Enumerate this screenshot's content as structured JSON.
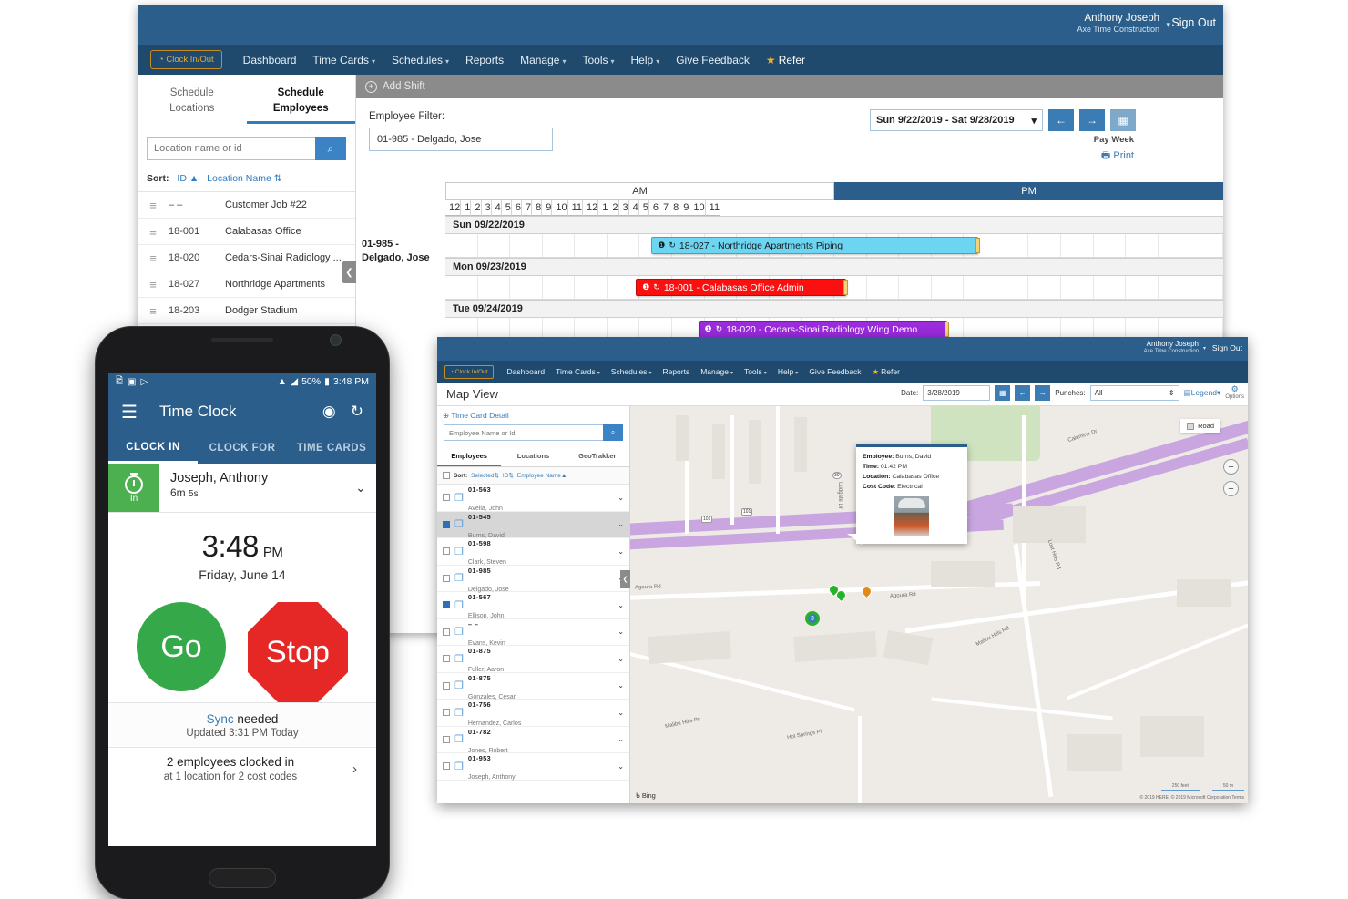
{
  "schedule_window": {
    "topbar": {
      "user_name": "Anthony Joseph",
      "company": "Axe Time Construction",
      "caret": "▾",
      "sign_out": "Sign Out"
    },
    "nav": {
      "clock_button": "Clock In/Out",
      "items": [
        {
          "label": "Dashboard",
          "has_caret": false
        },
        {
          "label": "Time Cards",
          "has_caret": true
        },
        {
          "label": "Schedules",
          "has_caret": true
        },
        {
          "label": "Reports",
          "has_caret": false
        },
        {
          "label": "Manage",
          "has_caret": true
        },
        {
          "label": "Tools",
          "has_caret": true
        },
        {
          "label": "Help",
          "has_caret": true
        },
        {
          "label": "Give Feedback",
          "has_caret": false
        }
      ],
      "refer": "Refer",
      "star": "★"
    },
    "sidebar": {
      "tab_locations_l1": "Schedule",
      "tab_locations_l2": "Locations",
      "tab_employees_l1": "Schedule",
      "tab_employees_l2": "Employees",
      "search_placeholder": "Location name or id",
      "search_icon": "search-icon",
      "sort_label": "Sort:",
      "sort_id": "ID",
      "sort_id_arrow": "▲",
      "sort_name": "Location Name",
      "sort_name_arrow": "⇅",
      "locations": [
        {
          "id": "– –",
          "name": "Customer Job #22"
        },
        {
          "id": "18-001",
          "name": "Calabasas Office"
        },
        {
          "id": "18-020",
          "name": "Cedars-Sinai Radiology ..."
        },
        {
          "id": "18-027",
          "name": "Northridge Apartments"
        },
        {
          "id": "18-203",
          "name": "Dodger Stadium"
        }
      ],
      "collapse": "❮"
    },
    "main": {
      "add_shift": "Add Shift",
      "filter_label": "Employee Filter:",
      "filter_value": "01-985 - Delgado, Jose",
      "date_range": "Sun 9/22/2019 - Sat 9/28/2019",
      "date_caret": "▾",
      "prev_arrow": "←",
      "next_arrow": "→",
      "calendar_icon": "calendar-icon",
      "pay_week": "Pay Week",
      "print": "Print",
      "print_icon": "printer-icon",
      "am_label": "AM",
      "pm_label": "PM",
      "hours": [
        "12",
        "1",
        "2",
        "3",
        "4",
        "5",
        "6",
        "7",
        "8",
        "9",
        "10",
        "11"
      ],
      "employee_row_label": "01-985 - Delgado, Jose",
      "days": [
        {
          "date_label": "Sun 09/22/2019",
          "shift": {
            "text": "18-027 - Northridge Apartments Piping",
            "bg": "#6cd5f2",
            "color": "#1a1a1a",
            "left_pct": 26.5,
            "width_pct": 42
          }
        },
        {
          "date_label": "Mon 09/23/2019",
          "shift": {
            "text": "18-001 - Calabasas Office Admin",
            "bg": "#fb0f0f",
            "color": "#ffffff",
            "left_pct": 24.5,
            "width_pct": 27
          }
        },
        {
          "date_label": "Tue 09/24/2019",
          "shift": {
            "text": "18-020 - Cedars-Sinai Radiology Wing Demo",
            "bg": "#9b2bdd",
            "color": "#ffffff",
            "left_pct": 32.5,
            "width_pct": 32
          }
        }
      ],
      "shift_info_icon": "info-icon",
      "shift_repeat_icon": "repeat-icon"
    }
  },
  "map_window": {
    "topbar": {
      "user_name": "Anthony Joseph",
      "company": "Axe Time Construction",
      "caret": "▾",
      "sign_out": "Sign Out"
    },
    "nav": {
      "clock_button": "Clock In/Out",
      "items": [
        {
          "label": "Dashboard",
          "has_caret": false
        },
        {
          "label": "Time Cards",
          "has_caret": true
        },
        {
          "label": "Schedules",
          "has_caret": true
        },
        {
          "label": "Reports",
          "has_caret": false
        },
        {
          "label": "Manage",
          "has_caret": true
        },
        {
          "label": "Tools",
          "has_caret": true
        },
        {
          "label": "Help",
          "has_caret": true
        },
        {
          "label": "Give Feedback",
          "has_caret": false
        }
      ],
      "refer": "Refer",
      "star": "★"
    },
    "subbar": {
      "title": "Map View",
      "date_label": "Date:",
      "date_value": "3/28/2019",
      "calendar_icon": "calendar-icon",
      "prev_arrow": "←",
      "next_arrow": "→",
      "punches_label": "Punches:",
      "punches_value": "All",
      "punches_caret": "⇕",
      "legend": "Legend",
      "legend_caret": "▾",
      "options": "Options",
      "gear_icon": "gear-icon"
    },
    "sidebar": {
      "time_card_detail": "Time Card Detail",
      "search_placeholder": "Employee Name or Id",
      "search_icon": "search-icon",
      "tabs": [
        {
          "label": "Employees",
          "active": true
        },
        {
          "label": "Locations",
          "active": false
        },
        {
          "label": "GeoTrakker",
          "active": false
        }
      ],
      "sort_label": "Sort:",
      "sort_selected": "Selected",
      "sort_selected_arrow": "⇅",
      "sort_id": "ID",
      "sort_id_arrow": "⇅",
      "sort_name": "Employee Name",
      "sort_name_arrow": "▲",
      "employees": [
        {
          "id": "01-563",
          "name": "Avella, John",
          "checked": false,
          "selected": false
        },
        {
          "id": "01-545",
          "name": "Burns, David",
          "checked": true,
          "selected": true
        },
        {
          "id": "01-598",
          "name": "Clark, Steven",
          "checked": false,
          "selected": false
        },
        {
          "id": "01-985",
          "name": "Delgado, Jose",
          "checked": false,
          "selected": false
        },
        {
          "id": "01-567",
          "name": "Ellison, John",
          "checked": true,
          "selected": false
        },
        {
          "id": "– –",
          "name": "Evans, Kevin",
          "checked": false,
          "selected": false
        },
        {
          "id": "01-875",
          "name": "Fuller, Aaron",
          "checked": false,
          "selected": false
        },
        {
          "id": "01-875",
          "name": "Gonzales, Cesar",
          "checked": false,
          "selected": false
        },
        {
          "id": "01-756",
          "name": "Hernandez, Carlos",
          "checked": false,
          "selected": false
        },
        {
          "id": "01-782",
          "name": "Jones, Robert",
          "checked": false,
          "selected": false
        },
        {
          "id": "01-953",
          "name": "Joseph, Anthony",
          "checked": false,
          "selected": false
        }
      ],
      "collapse": "❮"
    },
    "map": {
      "popup": {
        "employee_label": "Employee:",
        "employee_value": "Burns, David",
        "time_label": "Time:",
        "time_value": "01:42 PM",
        "location_label": "Location:",
        "location_value": "Calabasas Office",
        "cost_code_label": "Cost Code:",
        "cost_code_value": "Electrical",
        "photo": "employee-photo"
      },
      "map_type": "Road",
      "zoom_in": "+",
      "zoom_out": "−",
      "provider": "Bing",
      "attribution": "© 2019 HERE, © 2019 Microsoft Corporation  Terms",
      "scale_imperial": "250 feet",
      "scale_metric": "50 m",
      "cluster_count": "3",
      "road_labels": [
        "Agoura Rd",
        "Agoura Rd",
        "Malibu Hills Rd",
        "Malibu Hills Rd",
        "Hot Springs Pl",
        "Lost Hills Rd",
        "Calamine Dr",
        "Ludgate Dr"
      ],
      "highway_shields": [
        "101",
        "101",
        "30"
      ]
    }
  },
  "phone": {
    "status": {
      "icons_left": [
        "image-icon",
        "screenshot-icon",
        "play-icon"
      ],
      "wifi_icon": "wifi-icon",
      "signal_icon": "signal-icon",
      "battery_pct": "50%",
      "battery_icon": "battery-icon",
      "time": "3:48 PM"
    },
    "appbar": {
      "menu_icon": "hamburger-menu-icon",
      "title": "Time Clock",
      "gps_icon": "gps-target-icon",
      "sync_icon": "sync-refresh-icon"
    },
    "tabs": [
      {
        "label": "CLOCK IN",
        "active": true
      },
      {
        "label": "CLOCK FOR",
        "active": false
      },
      {
        "label": "TIME CARDS",
        "active": false
      }
    ],
    "card": {
      "status_badge": "In",
      "timer_icon": "stopwatch-icon",
      "name": "Joseph, Anthony",
      "duration_main": "6m",
      "duration_sec": "5s",
      "chevron": "⌄"
    },
    "clock": {
      "time": "3:48",
      "meridiem": "PM",
      "date": "Friday, June 14"
    },
    "buttons": {
      "go": "Go",
      "stop": "Stop"
    },
    "sync": {
      "link": "Sync",
      "rest": " needed",
      "updated": "Updated 3:31 PM Today"
    },
    "footer": {
      "line1": "2 employees clocked in",
      "line2": "at 1 location for 2 cost codes",
      "chevron": "›"
    }
  }
}
